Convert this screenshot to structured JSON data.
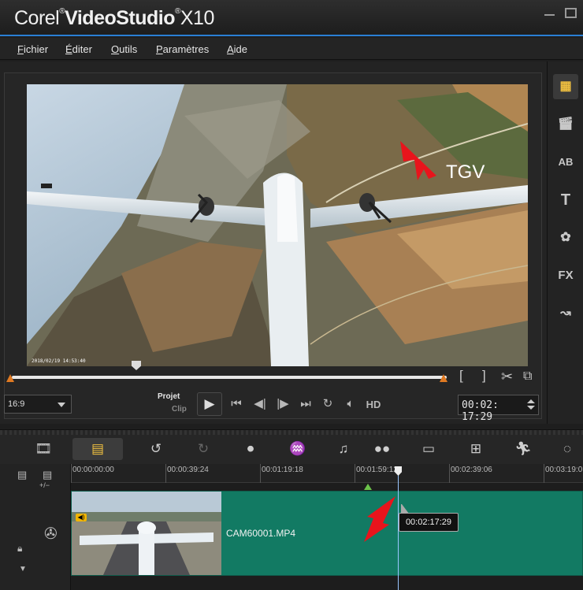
{
  "app": {
    "brand_prefix": "Corel",
    "brand_name": "VideoStudio",
    "brand_version": "X10"
  },
  "menu": [
    "Fichier",
    "Éditer",
    "Outils",
    "Paramètres",
    "Aide"
  ],
  "preview": {
    "annotation_label": "TGV",
    "video_timestamp": "2018/02/19 14:53:40"
  },
  "controls": {
    "aspect_ratio": "16:9",
    "mode_project": "Projet",
    "mode_clip": "Clip",
    "hd_label": "HD",
    "timecode": "00:02: 17:29"
  },
  "sidebar": {
    "items": [
      "media-icon",
      "instant-project-icon",
      "transition-icon",
      "title-icon",
      "graphic-icon",
      "filter-icon",
      "path-icon"
    ],
    "title_glyph": "T",
    "fx_glyph": "FX",
    "ab_glyph": "AB"
  },
  "timeline": {
    "ruler_ticks": [
      "00:00:00:00",
      "00:00:39:24",
      "00:01:19:18",
      "00:01:59:12",
      "00:02:39:06",
      "00:03:19:0"
    ],
    "clip_name": "CAM60001.MP4",
    "playhead_tooltip": "00:02:17:29",
    "track_zoom_label": "+/−"
  },
  "colors": {
    "accent": "#2a7fd4",
    "clip": "#127a63",
    "marker": "#e07a22",
    "selected_tool": "#f0c040",
    "annotation_arrow": "#e8141c"
  }
}
